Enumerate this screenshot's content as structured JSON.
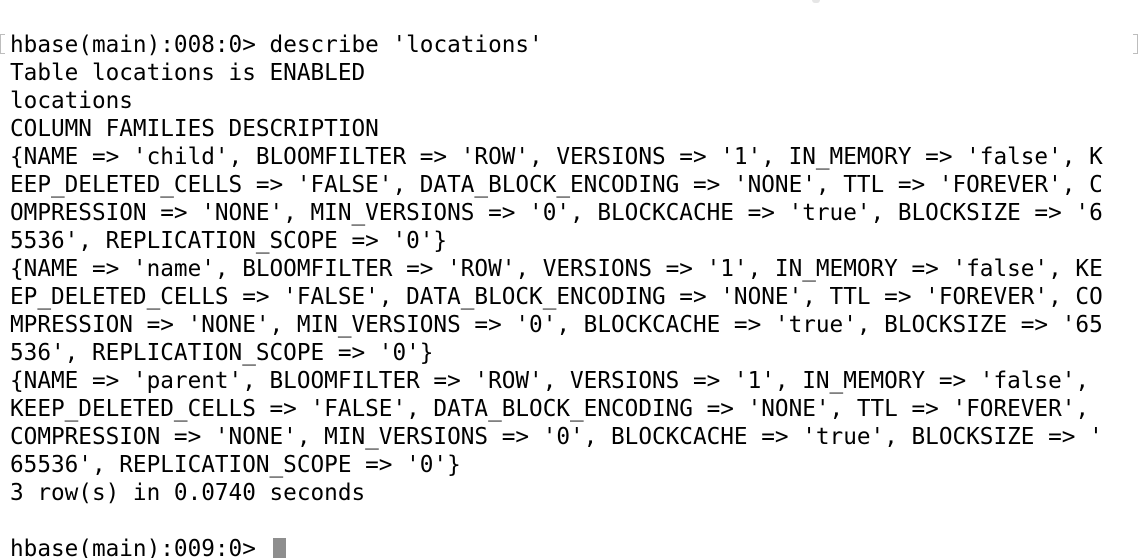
{
  "terminal": {
    "session": {
      "command_prompt": "hbase(main):008:0> ",
      "command": "describe 'locations'",
      "output": [
        "Table locations is ENABLED",
        "locations",
        "COLUMN FAMILIES DESCRIPTION",
        "{NAME => 'child', BLOOMFILTER => 'ROW', VERSIONS => '1', IN_MEMORY => 'false', K",
        "EEP_DELETED_CELLS => 'FALSE', DATA_BLOCK_ENCODING => 'NONE', TTL => 'FOREVER', C",
        "OMPRESSION => 'NONE', MIN_VERSIONS => '0', BLOCKCACHE => 'true', BLOCKSIZE => '6",
        "5536', REPLICATION_SCOPE => '0'}",
        "{NAME => 'name', BLOOMFILTER => 'ROW', VERSIONS => '1', IN_MEMORY => 'false', KE",
        "EP_DELETED_CELLS => 'FALSE', DATA_BLOCK_ENCODING => 'NONE', TTL => 'FOREVER', CO",
        "MPRESSION => 'NONE', MIN_VERSIONS => '0', BLOCKCACHE => 'true', BLOCKSIZE => '65",
        "536', REPLICATION_SCOPE => '0'}",
        "{NAME => 'parent', BLOOMFILTER => 'ROW', VERSIONS => '1', IN_MEMORY => 'false',",
        "KEEP_DELETED_CELLS => 'FALSE', DATA_BLOCK_ENCODING => 'NONE', TTL => 'FOREVER',",
        "COMPRESSION => 'NONE', MIN_VERSIONS => '0', BLOCKCACHE => 'true', BLOCKSIZE => '",
        "65536', REPLICATION_SCOPE => '0'}",
        "3 row(s) in 0.0740 seconds"
      ],
      "next_prompt": "hbase(main):009:0> "
    },
    "colors": {
      "background": "#ffffff",
      "text": "#000000",
      "cursor": "#8e8e8e"
    }
  }
}
